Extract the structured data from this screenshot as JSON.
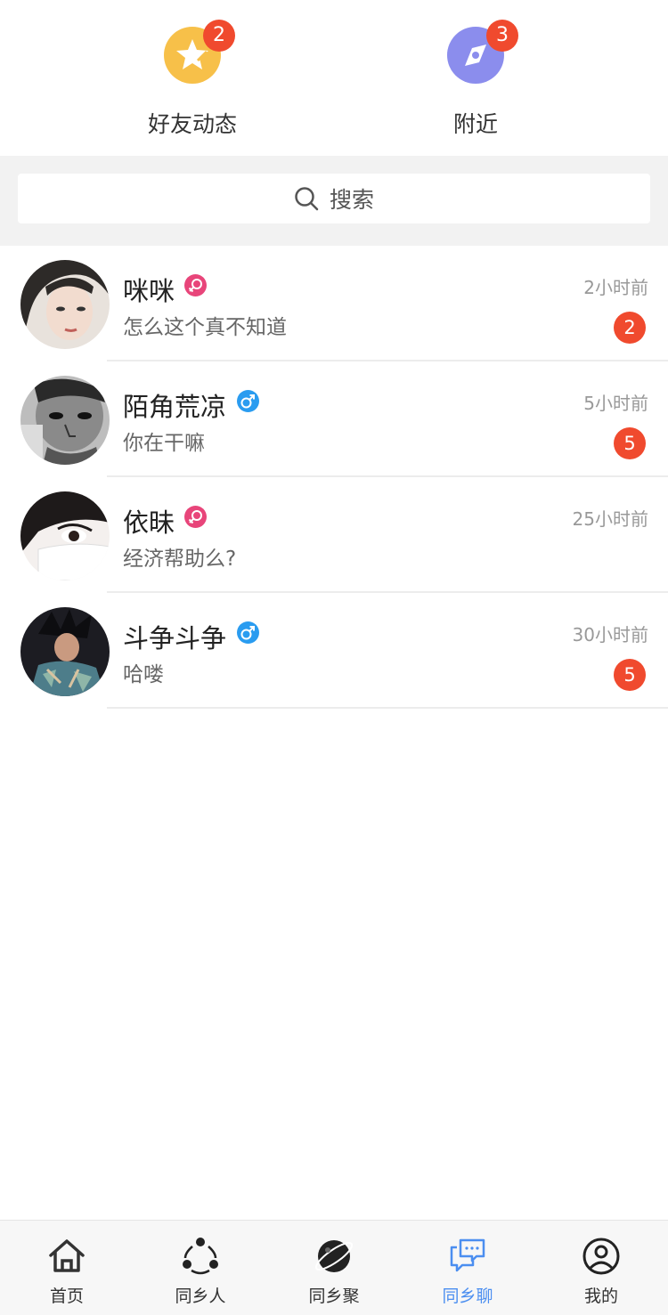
{
  "shortcuts": [
    {
      "label": "好友动态",
      "badge": "2",
      "icon": "star-icon",
      "color": "#f7c049"
    },
    {
      "label": "附近",
      "badge": "3",
      "icon": "compass-icon",
      "color": "#8b8ded"
    }
  ],
  "search": {
    "placeholder": "搜索"
  },
  "chats": [
    {
      "name": "咪咪",
      "gender": "female",
      "message": "怎么这个真不知道",
      "time": "2小时前",
      "unread": "2"
    },
    {
      "name": "陌角荒凉",
      "gender": "male",
      "message": "你在干嘛",
      "time": "5小时前",
      "unread": "5"
    },
    {
      "name": "依昧",
      "gender": "female",
      "message": "经济帮助么?",
      "time": "25小时前",
      "unread": ""
    },
    {
      "name": "斗争斗争",
      "gender": "male",
      "message": "哈喽",
      "time": "30小时前",
      "unread": "5"
    }
  ],
  "tabs": [
    {
      "label": "首页",
      "icon": "home-icon"
    },
    {
      "label": "同乡人",
      "icon": "people-icon"
    },
    {
      "label": "同乡聚",
      "icon": "planet-icon"
    },
    {
      "label": "同乡聊",
      "icon": "chat-icon",
      "active": true
    },
    {
      "label": "我的",
      "icon": "user-icon"
    }
  ],
  "colors": {
    "badge": "#f04a2e",
    "female": "#e8457a",
    "male": "#2a9cf0",
    "active_tab": "#4b8ef0"
  }
}
